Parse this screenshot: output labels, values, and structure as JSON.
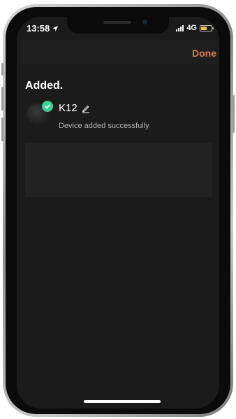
{
  "status_bar": {
    "time": "13:58",
    "network": "4G",
    "battery_color": "#f2c230"
  },
  "header": {
    "done_label": "Done",
    "accent_color": "#e07a4a"
  },
  "page": {
    "title": "Added."
  },
  "device": {
    "name": "K12",
    "status": "Device added successfully",
    "badge_color": "#3ecf8e",
    "icons": [
      "check-icon",
      "edit-pencil-icon"
    ]
  }
}
